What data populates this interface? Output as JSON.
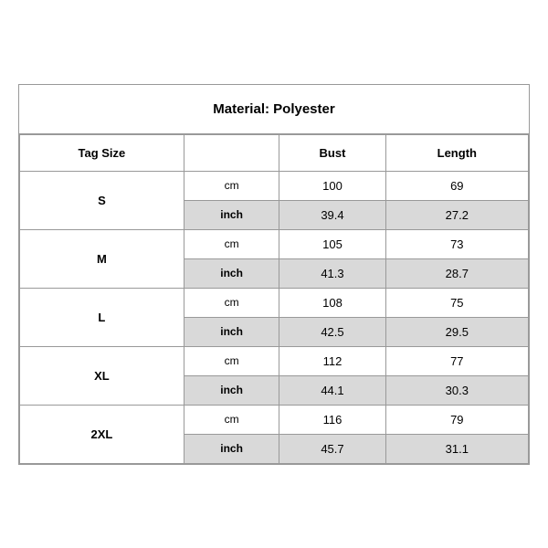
{
  "title": "Material: Polyester",
  "headers": {
    "tag_size": "Tag Size",
    "bust": "Bust",
    "length": "Length"
  },
  "sizes": [
    {
      "label": "S",
      "cm": {
        "bust": "100",
        "length": "69"
      },
      "inch": {
        "bust": "39.4",
        "length": "27.2"
      }
    },
    {
      "label": "M",
      "cm": {
        "bust": "105",
        "length": "73"
      },
      "inch": {
        "bust": "41.3",
        "length": "28.7"
      }
    },
    {
      "label": "L",
      "cm": {
        "bust": "108",
        "length": "75"
      },
      "inch": {
        "bust": "42.5",
        "length": "29.5"
      }
    },
    {
      "label": "XL",
      "cm": {
        "bust": "112",
        "length": "77"
      },
      "inch": {
        "bust": "44.1",
        "length": "30.3"
      }
    },
    {
      "label": "2XL",
      "cm": {
        "bust": "116",
        "length": "79"
      },
      "inch": {
        "bust": "45.7",
        "length": "31.1"
      }
    }
  ],
  "units": {
    "cm": "cm",
    "inch": "inch"
  }
}
